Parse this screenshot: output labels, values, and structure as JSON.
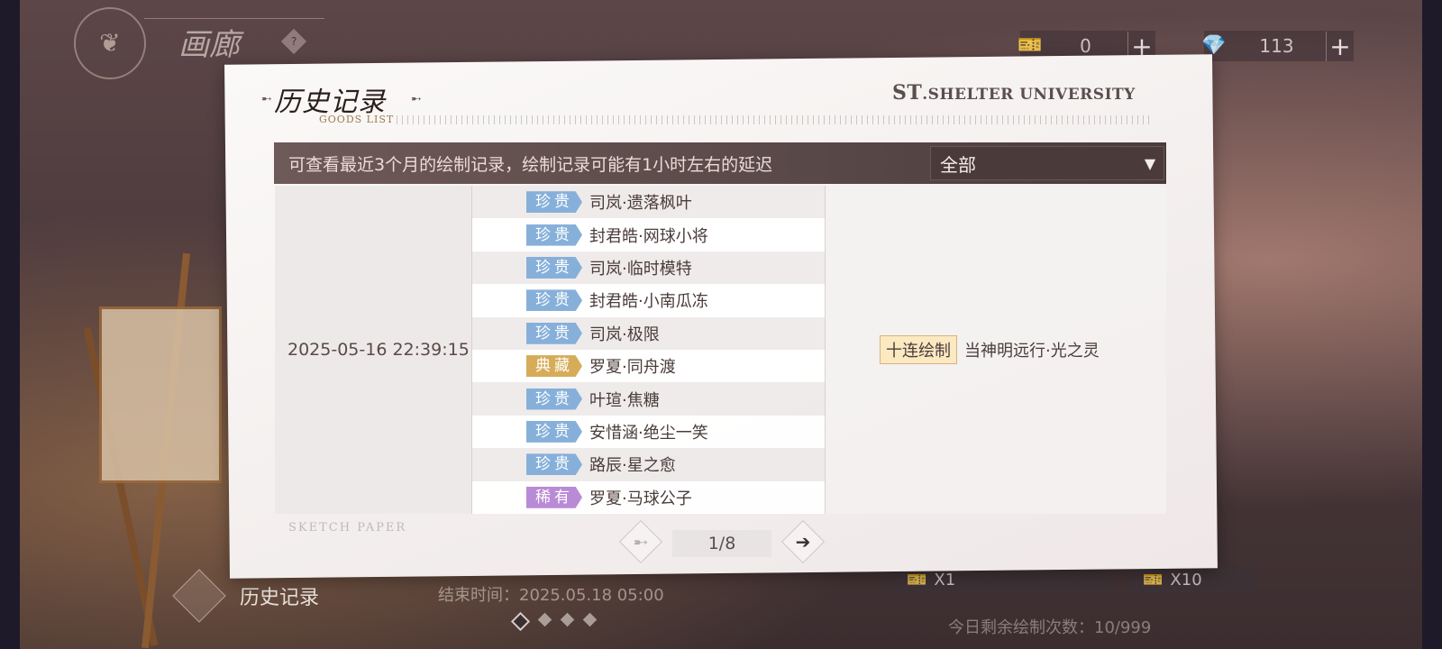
{
  "background": {
    "gallery_title": "画廊",
    "bottom_history_label": "历史记录",
    "end_time": "结束时间：2025.05.18  05:00",
    "draw_single": "X1",
    "draw_ten": "X10",
    "remaining": "今日剩余绘制次数：10/999",
    "carousel_dots": 4
  },
  "currency": [
    {
      "icon": "ticket-icon",
      "value": "0"
    },
    {
      "icon": "gem-icon",
      "value": "113"
    }
  ],
  "modal": {
    "title": "历史记录",
    "subtitle": "GOODS LIST",
    "brand_prefix": "ST",
    "brand_name": ".SHELTER UNIVERSITY",
    "filter_hint": "可查看最近3个月的绘制记录，绘制记录可能有1小时左右的延迟",
    "filter_value": "全部",
    "watermark": "SKETCH PAPER",
    "record": {
      "datetime": "2025-05-16  22:39:15",
      "draw_type": "十连绘制",
      "pool": "当神明远行·光之灵",
      "items": [
        {
          "rarity": "珍贵",
          "color": "#86b0da",
          "name": "司岚·遗落枫叶"
        },
        {
          "rarity": "珍贵",
          "color": "#86b0da",
          "name": "封君皓·网球小将"
        },
        {
          "rarity": "珍贵",
          "color": "#86b0da",
          "name": "司岚·临时模特"
        },
        {
          "rarity": "珍贵",
          "color": "#86b0da",
          "name": "封君皓·小南瓜冻"
        },
        {
          "rarity": "珍贵",
          "color": "#86b0da",
          "name": "司岚·极限"
        },
        {
          "rarity": "典藏",
          "color": "#d6ac58",
          "name": "罗夏·同舟渡"
        },
        {
          "rarity": "珍贵",
          "color": "#86b0da",
          "name": "叶瑄·焦糖"
        },
        {
          "rarity": "珍贵",
          "color": "#86b0da",
          "name": "安惜涵·绝尘一笑"
        },
        {
          "rarity": "珍贵",
          "color": "#86b0da",
          "name": "路辰·星之愈"
        },
        {
          "rarity": "稀有",
          "color": "#b98ad6",
          "name": "罗夏·马球公子"
        }
      ]
    },
    "pagination": {
      "current": 1,
      "total": 8,
      "label": "1/8"
    }
  }
}
